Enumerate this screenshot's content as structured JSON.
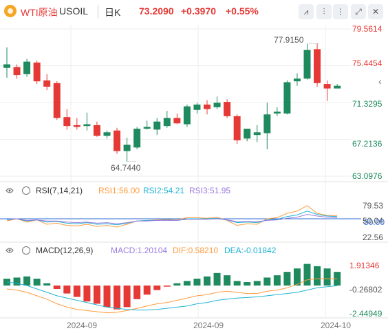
{
  "header": {
    "symbol_name": "WTI原油",
    "symbol_code": "USOIL",
    "timeframe": "日K",
    "price": "73.2090",
    "change": "+0.3970",
    "change_pct": "+0.55%",
    "tool_icons": [
      "line-tool-icon",
      "candle-tool-icon",
      "bar-tool-icon",
      "fullscreen-icon",
      "settings-icon"
    ]
  },
  "colors": {
    "up": "#e53935",
    "down": "#1e8a5e",
    "rsi1": "#ff9a3c",
    "rsi2": "#1fb4d4",
    "rsi3": "#9b7be0",
    "mline": "#2e6bd6",
    "dif": "#ff9a3c",
    "dea": "#1fb4d4"
  },
  "price_axis_labels": [
    "79.5614",
    "75.4454",
    "71.3295",
    "67.2136",
    "63.0976"
  ],
  "high_label": "77.9150",
  "low_label": "64.7440",
  "rsi": {
    "title": "RSI(7,14,21)",
    "rsi1": "RSI1:56.00",
    "rsi2": "RSI2:54.21",
    "rsi3": "RSI3:51.95",
    "axis": [
      "79.53",
      "50.04",
      "22.56"
    ],
    "mid_label": "50.00"
  },
  "macd": {
    "title": "MACD(12,26,9)",
    "macd": "MACD:1.20104",
    "dif": "DIF:0.58210",
    "dea": "DEA:-0.01842",
    "axis": [
      "1.91346",
      "-0.26802",
      "-2.44949"
    ]
  },
  "x_axis_labels": [
    "2024-09",
    "2024-09",
    "2024-10"
  ],
  "chart_data": [
    {
      "type": "candlestick",
      "title": "WTI原油 USOIL 日K",
      "ylim": [
        63.0976,
        79.5614
      ],
      "yticks": [
        79.5614,
        75.4454,
        71.3295,
        67.2136,
        63.0976
      ],
      "candles": [
        {
          "o": 75.2,
          "h": 77.5,
          "l": 74.1,
          "c": 75.6
        },
        {
          "o": 75.3,
          "h": 75.6,
          "l": 74.0,
          "c": 74.4
        },
        {
          "o": 74.5,
          "h": 76.2,
          "l": 74.2,
          "c": 75.9
        },
        {
          "o": 75.8,
          "h": 76.0,
          "l": 73.4,
          "c": 73.7
        },
        {
          "o": 73.8,
          "h": 74.5,
          "l": 72.7,
          "c": 73.1
        },
        {
          "o": 73.5,
          "h": 73.7,
          "l": 69.4,
          "c": 69.6
        },
        {
          "o": 69.7,
          "h": 70.6,
          "l": 68.3,
          "c": 68.7
        },
        {
          "o": 68.8,
          "h": 69.6,
          "l": 68.3,
          "c": 68.6
        },
        {
          "o": 68.7,
          "h": 70.2,
          "l": 68.2,
          "c": 68.9
        },
        {
          "o": 68.8,
          "h": 69.2,
          "l": 67.5,
          "c": 67.6
        },
        {
          "o": 67.6,
          "h": 68.2,
          "l": 67.3,
          "c": 68.0
        },
        {
          "o": 68.2,
          "h": 68.5,
          "l": 65.6,
          "c": 65.9
        },
        {
          "o": 65.9,
          "h": 67.4,
          "l": 64.7,
          "c": 66.6
        },
        {
          "o": 66.3,
          "h": 68.6,
          "l": 66.1,
          "c": 68.4
        },
        {
          "o": 68.4,
          "h": 69.3,
          "l": 68.3,
          "c": 68.6
        },
        {
          "o": 68.3,
          "h": 69.6,
          "l": 67.7,
          "c": 69.2
        },
        {
          "o": 68.7,
          "h": 70.4,
          "l": 68.5,
          "c": 69.6
        },
        {
          "o": 69.6,
          "h": 70.1,
          "l": 68.9,
          "c": 69.0
        },
        {
          "o": 68.9,
          "h": 71.1,
          "l": 68.6,
          "c": 70.9
        },
        {
          "o": 70.5,
          "h": 71.3,
          "l": 70.1,
          "c": 71.1
        },
        {
          "o": 71.1,
          "h": 71.6,
          "l": 70.0,
          "c": 70.6
        },
        {
          "o": 70.8,
          "h": 72.0,
          "l": 70.6,
          "c": 71.3
        },
        {
          "o": 71.4,
          "h": 71.7,
          "l": 69.6,
          "c": 69.8
        },
        {
          "o": 69.8,
          "h": 70.0,
          "l": 66.7,
          "c": 67.1
        },
        {
          "o": 67.3,
          "h": 68.1,
          "l": 67.0,
          "c": 68.4
        },
        {
          "o": 67.7,
          "h": 68.8,
          "l": 66.9,
          "c": 68.0
        },
        {
          "o": 67.9,
          "h": 71.3,
          "l": 66.1,
          "c": 70.0
        },
        {
          "o": 70.1,
          "h": 70.8,
          "l": 69.8,
          "c": 70.3
        },
        {
          "o": 70.1,
          "h": 73.8,
          "l": 70.0,
          "c": 73.6
        },
        {
          "o": 73.7,
          "h": 74.6,
          "l": 73.2,
          "c": 74.0
        },
        {
          "o": 74.0,
          "h": 77.9,
          "l": 73.9,
          "c": 77.2
        },
        {
          "o": 77.3,
          "h": 77.9,
          "l": 73.1,
          "c": 73.5
        },
        {
          "o": 73.4,
          "h": 73.8,
          "l": 71.5,
          "c": 72.9
        },
        {
          "o": 72.9,
          "h": 73.4,
          "l": 72.9,
          "c": 73.2
        }
      ]
    },
    {
      "type": "line",
      "title": "RSI(7,14,21)",
      "yticks": [
        79.53,
        50.04,
        22.56
      ],
      "series": [
        {
          "name": "RSI1",
          "values": [
            46,
            50,
            44,
            48,
            40,
            42,
            38,
            37,
            40,
            36,
            38,
            35,
            40,
            46,
            47,
            48,
            49,
            48,
            52,
            52,
            51,
            53,
            47,
            38,
            41,
            40,
            50,
            52,
            60,
            64,
            74,
            60,
            56,
            56
          ]
        },
        {
          "name": "RSI2",
          "values": [
            48,
            50,
            46,
            48,
            44,
            45,
            42,
            41,
            43,
            40,
            41,
            39,
            42,
            46,
            47,
            47,
            48,
            47,
            50,
            50,
            50,
            51,
            48,
            43,
            44,
            43,
            48,
            49,
            54,
            57,
            64,
            58,
            55,
            54
          ]
        },
        {
          "name": "RSI3",
          "values": [
            49,
            50,
            47,
            48,
            46,
            46,
            44,
            43,
            44,
            42,
            43,
            41,
            43,
            46,
            46,
            47,
            47,
            47,
            49,
            49,
            49,
            50,
            48,
            45,
            45,
            45,
            47,
            48,
            51,
            53,
            58,
            55,
            53,
            52
          ]
        }
      ]
    },
    {
      "type": "bar",
      "title": "MACD(12,26,9)",
      "yticks": [
        1.91346,
        -0.26802,
        -2.44949
      ],
      "values": [
        0.6,
        0.7,
        0.8,
        0.6,
        0.2,
        -0.3,
        -0.7,
        -1.0,
        -1.4,
        -1.6,
        -1.9,
        -2.1,
        -1.9,
        -1.2,
        -0.8,
        -0.4,
        -0.1,
        0.2,
        0.4,
        0.6,
        0.8,
        1.1,
        0.9,
        0.4,
        0.3,
        0.4,
        0.7,
        0.9,
        1.2,
        1.5,
        1.9,
        1.7,
        1.5,
        1.2
      ],
      "series": [
        {
          "name": "DIF",
          "values": [
            -0.3,
            -0.4,
            -0.6,
            -0.9,
            -1.2,
            -1.6,
            -1.9,
            -2.1,
            -2.2,
            -2.3,
            -2.4,
            -2.35,
            -2.2,
            -2.0,
            -1.8,
            -1.6,
            -1.5,
            -1.3,
            -1.1,
            -0.9,
            -0.8,
            -0.6,
            -0.5,
            -0.6,
            -0.7,
            -0.7,
            -0.5,
            -0.4,
            -0.2,
            0.1,
            0.5,
            0.6,
            0.6,
            0.58
          ]
        },
        {
          "name": "DEA",
          "values": [
            0.3,
            0.2,
            0.0,
            -0.3,
            -0.6,
            -0.9,
            -1.1,
            -1.3,
            -1.5,
            -1.7,
            -1.9,
            -2.0,
            -2.1,
            -2.15,
            -2.15,
            -2.1,
            -2.0,
            -1.9,
            -1.8,
            -1.6,
            -1.5,
            -1.3,
            -1.2,
            -1.1,
            -1.05,
            -1.0,
            -0.9,
            -0.8,
            -0.7,
            -0.6,
            -0.4,
            -0.2,
            -0.1,
            -0.02
          ]
        }
      ]
    }
  ]
}
